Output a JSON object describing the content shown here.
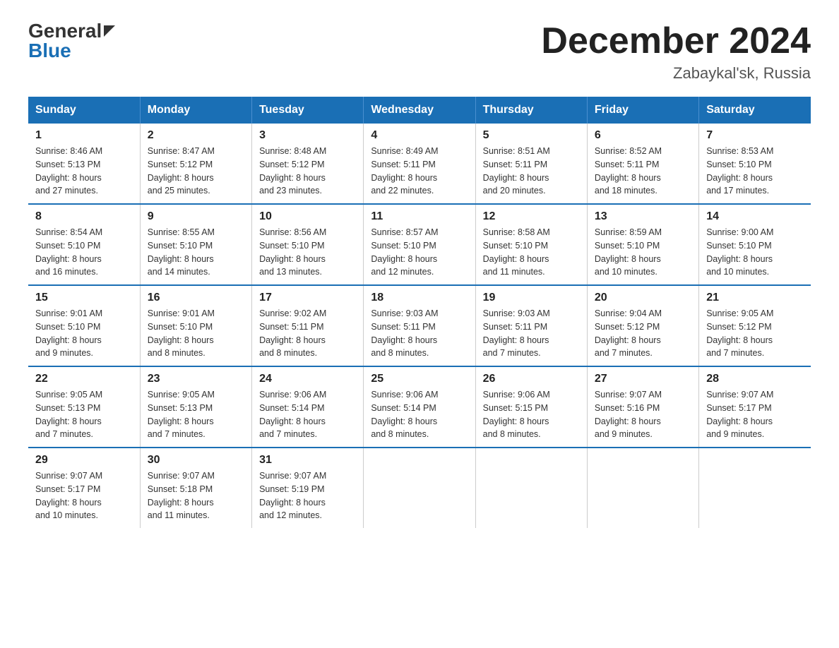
{
  "logo": {
    "general": "General",
    "blue": "Blue"
  },
  "header": {
    "month": "December 2024",
    "location": "Zabaykal'sk, Russia"
  },
  "weekdays": [
    "Sunday",
    "Monday",
    "Tuesday",
    "Wednesday",
    "Thursday",
    "Friday",
    "Saturday"
  ],
  "weeks": [
    [
      {
        "day": "1",
        "info": "Sunrise: 8:46 AM\nSunset: 5:13 PM\nDaylight: 8 hours\nand 27 minutes."
      },
      {
        "day": "2",
        "info": "Sunrise: 8:47 AM\nSunset: 5:12 PM\nDaylight: 8 hours\nand 25 minutes."
      },
      {
        "day": "3",
        "info": "Sunrise: 8:48 AM\nSunset: 5:12 PM\nDaylight: 8 hours\nand 23 minutes."
      },
      {
        "day": "4",
        "info": "Sunrise: 8:49 AM\nSunset: 5:11 PM\nDaylight: 8 hours\nand 22 minutes."
      },
      {
        "day": "5",
        "info": "Sunrise: 8:51 AM\nSunset: 5:11 PM\nDaylight: 8 hours\nand 20 minutes."
      },
      {
        "day": "6",
        "info": "Sunrise: 8:52 AM\nSunset: 5:11 PM\nDaylight: 8 hours\nand 18 minutes."
      },
      {
        "day": "7",
        "info": "Sunrise: 8:53 AM\nSunset: 5:10 PM\nDaylight: 8 hours\nand 17 minutes."
      }
    ],
    [
      {
        "day": "8",
        "info": "Sunrise: 8:54 AM\nSunset: 5:10 PM\nDaylight: 8 hours\nand 16 minutes."
      },
      {
        "day": "9",
        "info": "Sunrise: 8:55 AM\nSunset: 5:10 PM\nDaylight: 8 hours\nand 14 minutes."
      },
      {
        "day": "10",
        "info": "Sunrise: 8:56 AM\nSunset: 5:10 PM\nDaylight: 8 hours\nand 13 minutes."
      },
      {
        "day": "11",
        "info": "Sunrise: 8:57 AM\nSunset: 5:10 PM\nDaylight: 8 hours\nand 12 minutes."
      },
      {
        "day": "12",
        "info": "Sunrise: 8:58 AM\nSunset: 5:10 PM\nDaylight: 8 hours\nand 11 minutes."
      },
      {
        "day": "13",
        "info": "Sunrise: 8:59 AM\nSunset: 5:10 PM\nDaylight: 8 hours\nand 10 minutes."
      },
      {
        "day": "14",
        "info": "Sunrise: 9:00 AM\nSunset: 5:10 PM\nDaylight: 8 hours\nand 10 minutes."
      }
    ],
    [
      {
        "day": "15",
        "info": "Sunrise: 9:01 AM\nSunset: 5:10 PM\nDaylight: 8 hours\nand 9 minutes."
      },
      {
        "day": "16",
        "info": "Sunrise: 9:01 AM\nSunset: 5:10 PM\nDaylight: 8 hours\nand 8 minutes."
      },
      {
        "day": "17",
        "info": "Sunrise: 9:02 AM\nSunset: 5:11 PM\nDaylight: 8 hours\nand 8 minutes."
      },
      {
        "day": "18",
        "info": "Sunrise: 9:03 AM\nSunset: 5:11 PM\nDaylight: 8 hours\nand 8 minutes."
      },
      {
        "day": "19",
        "info": "Sunrise: 9:03 AM\nSunset: 5:11 PM\nDaylight: 8 hours\nand 7 minutes."
      },
      {
        "day": "20",
        "info": "Sunrise: 9:04 AM\nSunset: 5:12 PM\nDaylight: 8 hours\nand 7 minutes."
      },
      {
        "day": "21",
        "info": "Sunrise: 9:05 AM\nSunset: 5:12 PM\nDaylight: 8 hours\nand 7 minutes."
      }
    ],
    [
      {
        "day": "22",
        "info": "Sunrise: 9:05 AM\nSunset: 5:13 PM\nDaylight: 8 hours\nand 7 minutes."
      },
      {
        "day": "23",
        "info": "Sunrise: 9:05 AM\nSunset: 5:13 PM\nDaylight: 8 hours\nand 7 minutes."
      },
      {
        "day": "24",
        "info": "Sunrise: 9:06 AM\nSunset: 5:14 PM\nDaylight: 8 hours\nand 7 minutes."
      },
      {
        "day": "25",
        "info": "Sunrise: 9:06 AM\nSunset: 5:14 PM\nDaylight: 8 hours\nand 8 minutes."
      },
      {
        "day": "26",
        "info": "Sunrise: 9:06 AM\nSunset: 5:15 PM\nDaylight: 8 hours\nand 8 minutes."
      },
      {
        "day": "27",
        "info": "Sunrise: 9:07 AM\nSunset: 5:16 PM\nDaylight: 8 hours\nand 9 minutes."
      },
      {
        "day": "28",
        "info": "Sunrise: 9:07 AM\nSunset: 5:17 PM\nDaylight: 8 hours\nand 9 minutes."
      }
    ],
    [
      {
        "day": "29",
        "info": "Sunrise: 9:07 AM\nSunset: 5:17 PM\nDaylight: 8 hours\nand 10 minutes."
      },
      {
        "day": "30",
        "info": "Sunrise: 9:07 AM\nSunset: 5:18 PM\nDaylight: 8 hours\nand 11 minutes."
      },
      {
        "day": "31",
        "info": "Sunrise: 9:07 AM\nSunset: 5:19 PM\nDaylight: 8 hours\nand 12 minutes."
      },
      {
        "day": "",
        "info": ""
      },
      {
        "day": "",
        "info": ""
      },
      {
        "day": "",
        "info": ""
      },
      {
        "day": "",
        "info": ""
      }
    ]
  ]
}
